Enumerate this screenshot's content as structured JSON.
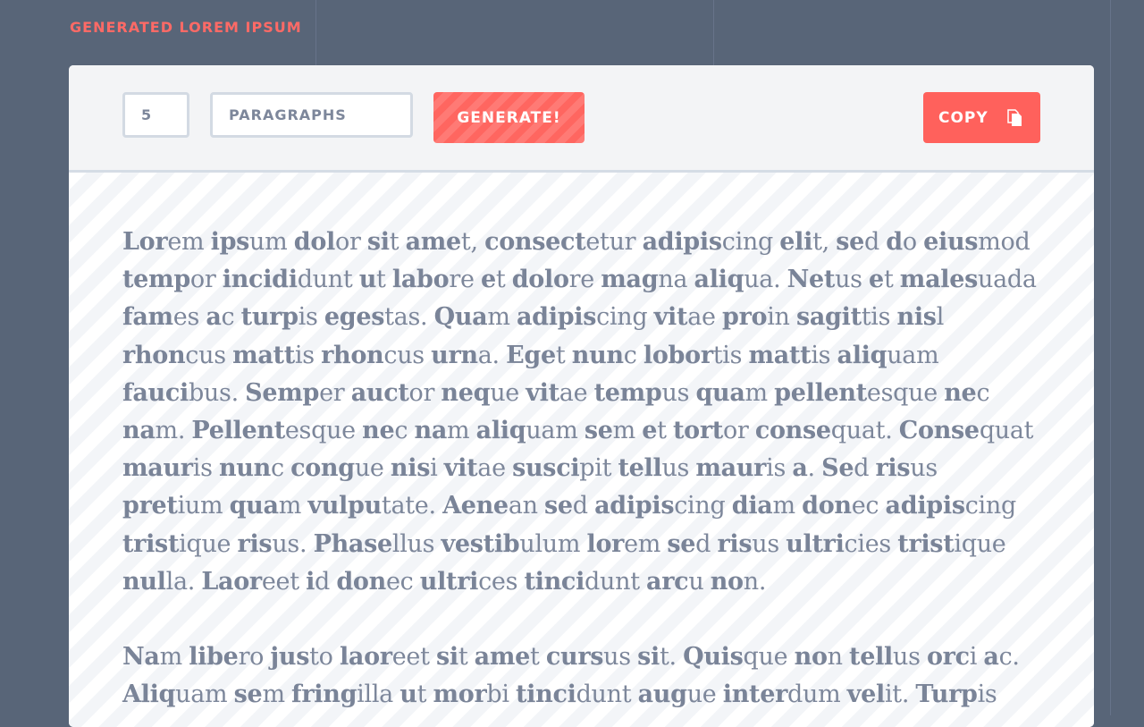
{
  "header": {
    "title": "GENERATED LOREM IPSUM"
  },
  "toolbar": {
    "count_value": "5",
    "unit_value": "PARAGRAPHS",
    "generate_label": "GENERATE!",
    "copy_label": "COPY",
    "copy_icon": "copy-icon"
  },
  "colors": {
    "background": "#586578",
    "accent": "#ff615c",
    "text": "#7d879b"
  },
  "content": {
    "paragraphs": [
      "Lorem ipsum dolor sit amet, consectetur adipiscing elit, sed do eiusmod tempor incididunt ut labore et dolore magna aliqua. Netus et malesuada fames ac turpis egestas. Quam adipiscing vitae proin sagittis nisl rhoncus mattis rhoncus urna. Eget nunc lobortis mattis aliquam faucibus. Semper auctor neque vitae tempus quam pellentesque nec nam. Pellentesque nec nam aliquam sem et tortor consequat. Consequat mauris nunc congue nisi vitae suscipit tellus mauris a. Sed risus pretium quam vulputate. Aenean sed adipiscing diam donec adipiscing tristique risus. Phasellus vestibulum lorem sed risus ultricies tristique nulla. Laoreet id donec ultrices tincidunt arcu non.",
      "Nam libero justo laoreet sit amet cursus sit. Quisque non tellus orci ac. Aliquam sem fringilla ut morbi tincidunt augue interdum velit. Turpis"
    ]
  }
}
